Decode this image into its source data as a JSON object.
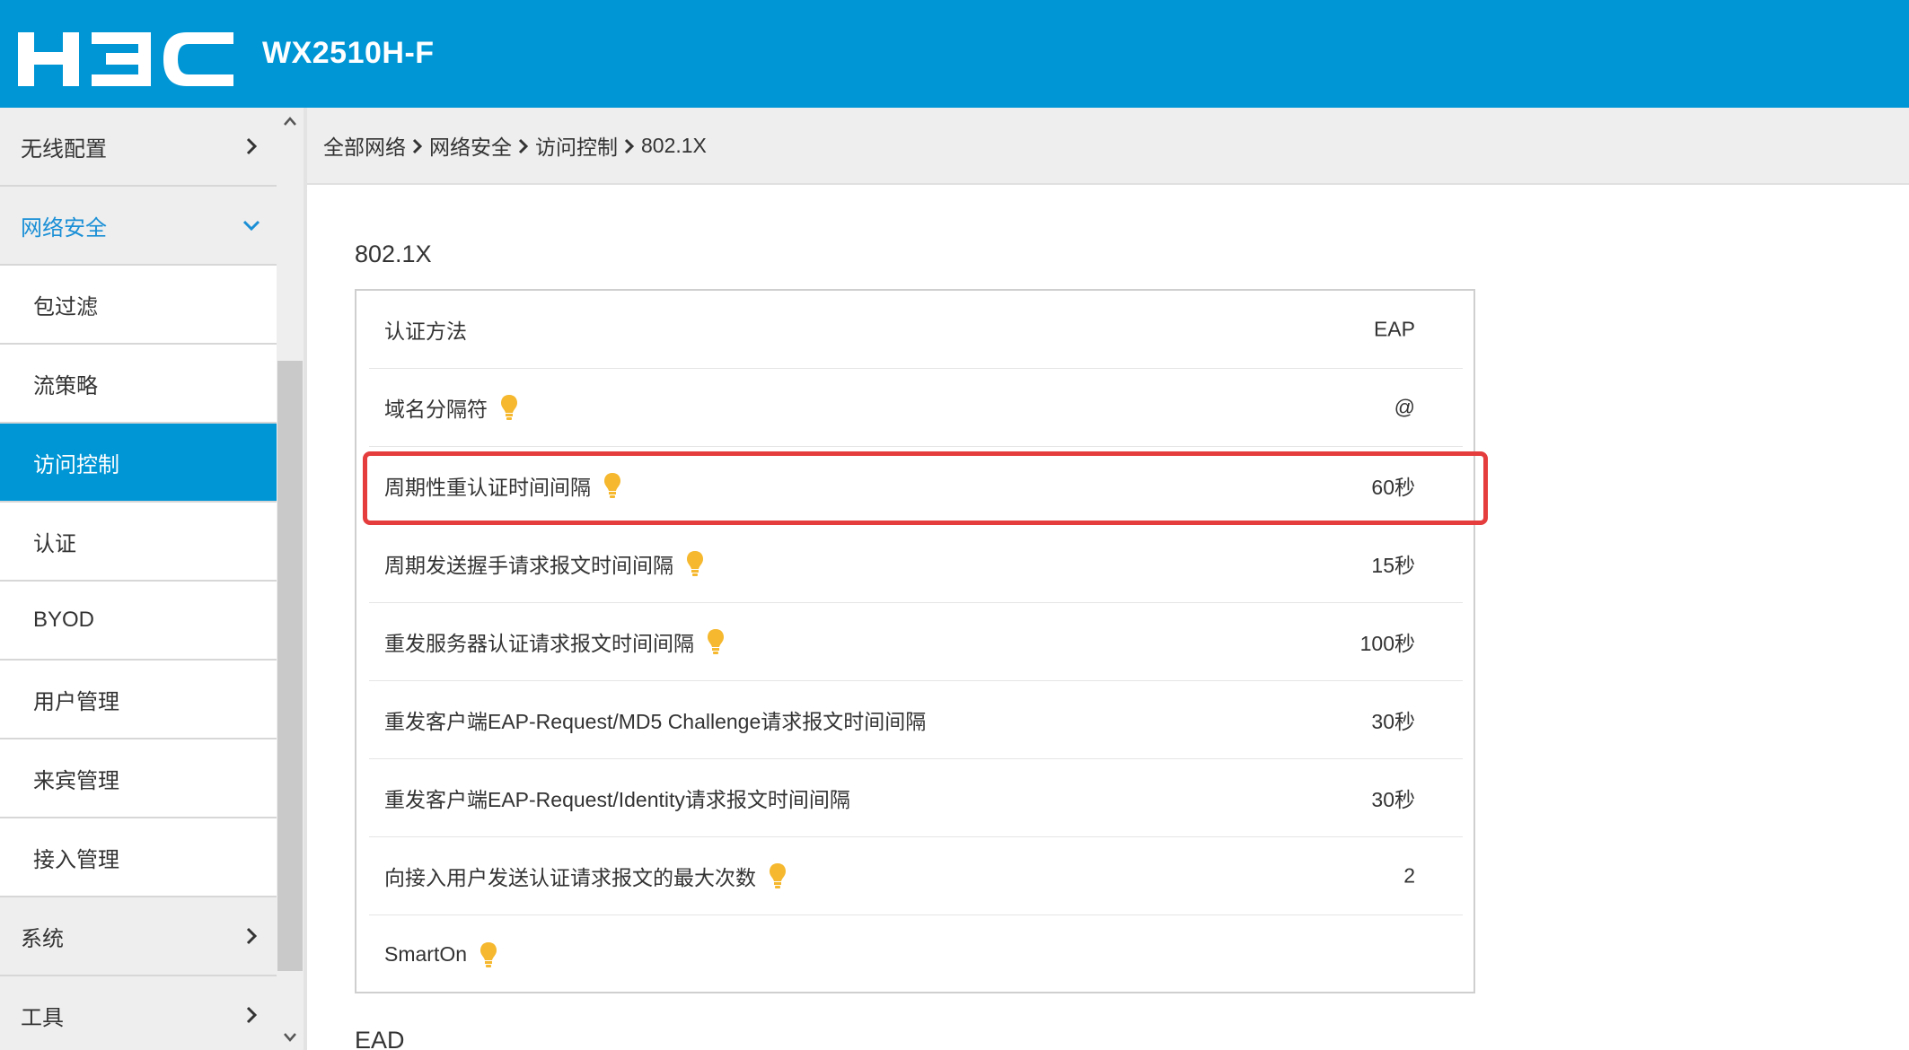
{
  "header": {
    "logo": "H3C",
    "model": "WX2510H-F"
  },
  "sidebar": {
    "items": [
      {
        "label": "无线配置",
        "type": "group",
        "state": "collapsed"
      },
      {
        "label": "网络安全",
        "type": "group",
        "state": "expanded"
      },
      {
        "label": "包过滤",
        "type": "sub"
      },
      {
        "label": "流策略",
        "type": "sub"
      },
      {
        "label": "访问控制",
        "type": "sub",
        "active": true
      },
      {
        "label": "认证",
        "type": "sub"
      },
      {
        "label": "BYOD",
        "type": "sub"
      },
      {
        "label": "用户管理",
        "type": "sub"
      },
      {
        "label": "来宾管理",
        "type": "sub"
      },
      {
        "label": "接入管理",
        "type": "sub"
      },
      {
        "label": "系统",
        "type": "group",
        "state": "collapsed"
      },
      {
        "label": "工具",
        "type": "group",
        "state": "collapsed"
      }
    ]
  },
  "breadcrumb": [
    "全部网络",
    "网络安全",
    "访问控制",
    "802.1X"
  ],
  "section": {
    "title": "802.1X",
    "rows": [
      {
        "label": "认证方法",
        "value": "EAP",
        "hint": false
      },
      {
        "label": "域名分隔符",
        "value": "@",
        "hint": true
      },
      {
        "label": "周期性重认证时间间隔",
        "value": "60秒",
        "hint": true,
        "highlighted": true
      },
      {
        "label": "周期发送握手请求报文时间间隔",
        "value": "15秒",
        "hint": true
      },
      {
        "label": "重发服务器认证请求报文时间间隔",
        "value": "100秒",
        "hint": true
      },
      {
        "label": "重发客户端EAP-Request/MD5 Challenge请求报文时间间隔",
        "value": "30秒",
        "hint": false
      },
      {
        "label": "重发客户端EAP-Request/Identity请求报文时间间隔",
        "value": "30秒",
        "hint": false
      },
      {
        "label": "向接入用户发送认证请求报文的最大次数",
        "value": "2",
        "hint": true
      },
      {
        "label": "SmartOn",
        "value": "",
        "hint": true
      }
    ]
  },
  "next_section": {
    "title": "EAD"
  },
  "colors": {
    "header": "#0096d6",
    "active_nav": "#0096d6",
    "expanded_group_text": "#1a8fd6",
    "highlight_border": "#e53d3d",
    "hint_bulb": "#f5b82e"
  }
}
